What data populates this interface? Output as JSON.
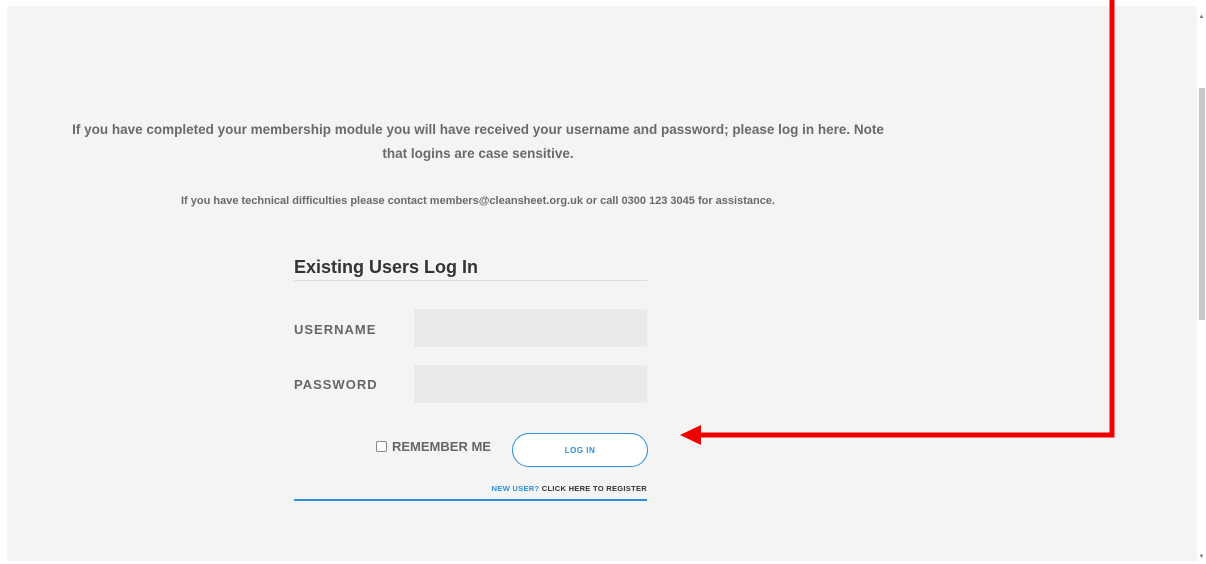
{
  "intro_text": "If you have completed your membership module you will have received your username and password; please log in here. Note that logins are case sensitive.",
  "support_text": "If you have technical difficulties please contact members@cleansheet.org.uk or call 0300 123 3045 for assistance.",
  "login_form": {
    "title": "Existing Users Log In",
    "username_label": "USERNAME",
    "username_value": "",
    "password_label": "PASSWORD",
    "password_value": "",
    "remember_label": "REMEMBER ME",
    "remember_checked": false,
    "login_button_label": "LOG IN",
    "new_user_label": "NEW USER?",
    "register_link_label": "CLICK HERE TO REGISTER"
  },
  "colors": {
    "accent": "#2b8fd8",
    "annotation_arrow": "#ee0000",
    "page_background": "#f4f4f4"
  },
  "icons": {
    "scroll_up": "triangle-up-icon",
    "scroll_down": "triangle-down-icon",
    "checkbox": "checkbox-icon",
    "annotation": "red-arrow-icon"
  }
}
